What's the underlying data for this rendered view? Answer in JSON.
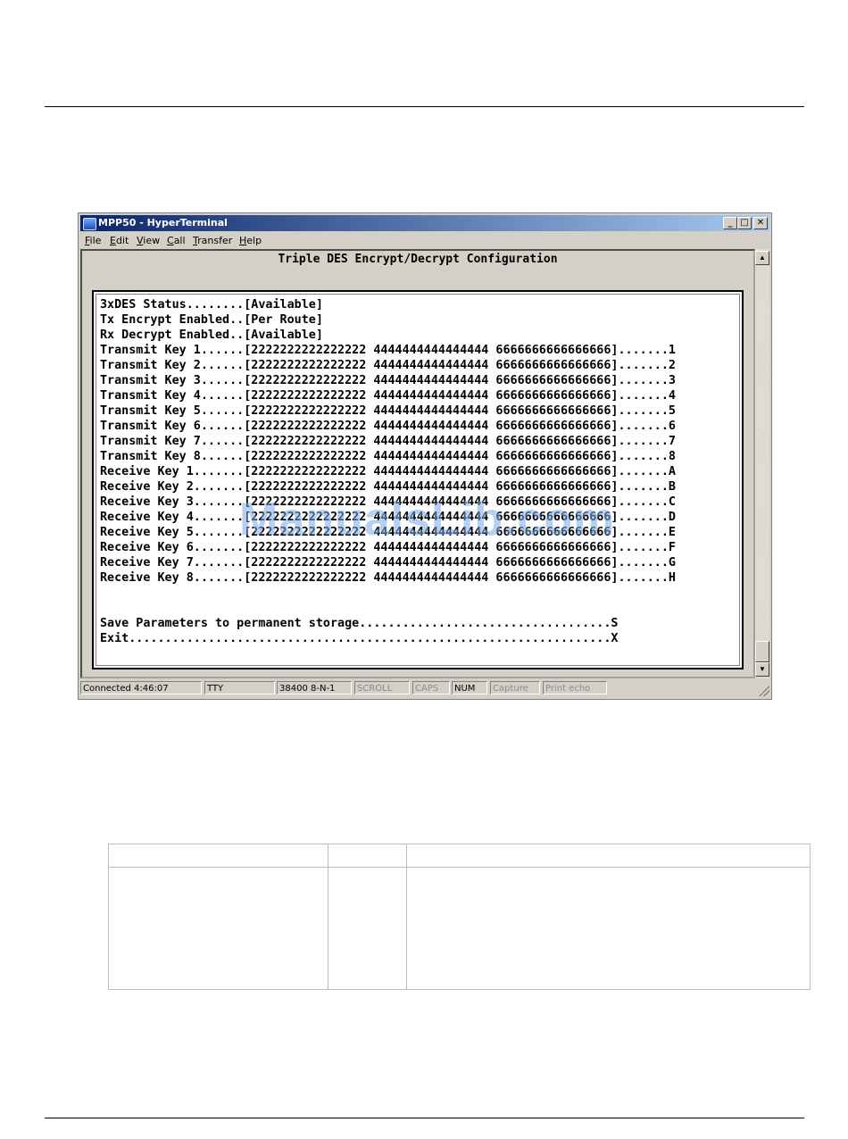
{
  "window": {
    "title": "MPP50 - HyperTerminal",
    "controls": {
      "minimize": "_",
      "maximize": "□",
      "close": "✕"
    }
  },
  "menu": [
    {
      "accel": "F",
      "rest": "ile"
    },
    {
      "accel": "E",
      "rest": "dit"
    },
    {
      "accel": "V",
      "rest": "iew"
    },
    {
      "accel": "C",
      "rest": "all"
    },
    {
      "accel": "T",
      "rest": "ransfer"
    },
    {
      "accel": "H",
      "rest": "elp"
    }
  ],
  "terminal": {
    "heading": "Triple DES Encrypt/Decrypt Configuration",
    "lines": [
      "3xDES Status........[Available]",
      "Tx Encrypt Enabled..[Per Route]",
      "Rx Decrypt Enabled..[Available]",
      "Transmit Key 1......[2222222222222222 4444444444444444 6666666666666666].......1",
      "Transmit Key 2......[2222222222222222 4444444444444444 6666666666666666].......2",
      "Transmit Key 3......[2222222222222222 4444444444444444 6666666666666666].......3",
      "Transmit Key 4......[2222222222222222 4444444444444444 6666666666666666].......4",
      "Transmit Key 5......[2222222222222222 4444444444444444 6666666666666666].......5",
      "Transmit Key 6......[2222222222222222 4444444444444444 6666666666666666].......6",
      "Transmit Key 7......[2222222222222222 4444444444444444 6666666666666666].......7",
      "Transmit Key 8......[2222222222222222 4444444444444444 6666666666666666].......8",
      "Receive Key 1.......[2222222222222222 4444444444444444 6666666666666666].......A",
      "Receive Key 2.......[2222222222222222 4444444444444444 6666666666666666].......B",
      "Receive Key 3.......[2222222222222222 4444444444444444 6666666666666666].......C",
      "Receive Key 4.......[2222222222222222 4444444444444444 6666666666666666].......D",
      "Receive Key 5.......[2222222222222222 4444444444444444 6666666666666666].......E",
      "Receive Key 6.......[2222222222222222 4444444444444444 6666666666666666].......F",
      "Receive Key 7.......[2222222222222222 4444444444444444 6666666666666666].......G",
      "Receive Key 8.......[2222222222222222 4444444444444444 6666666666666666].......H",
      "Save Parameters to permanent storage...................................S",
      "Exit...................................................................X"
    ]
  },
  "statusbar": {
    "connected": "Connected 4:46:07",
    "emulation": "TTY",
    "port_settings": "38400 8-N-1",
    "scroll": "SCROLL",
    "caps": "CAPS",
    "num": "NUM",
    "capture": "Capture",
    "print_echo": "Print echo"
  },
  "watermark": "ManualsLib.com"
}
